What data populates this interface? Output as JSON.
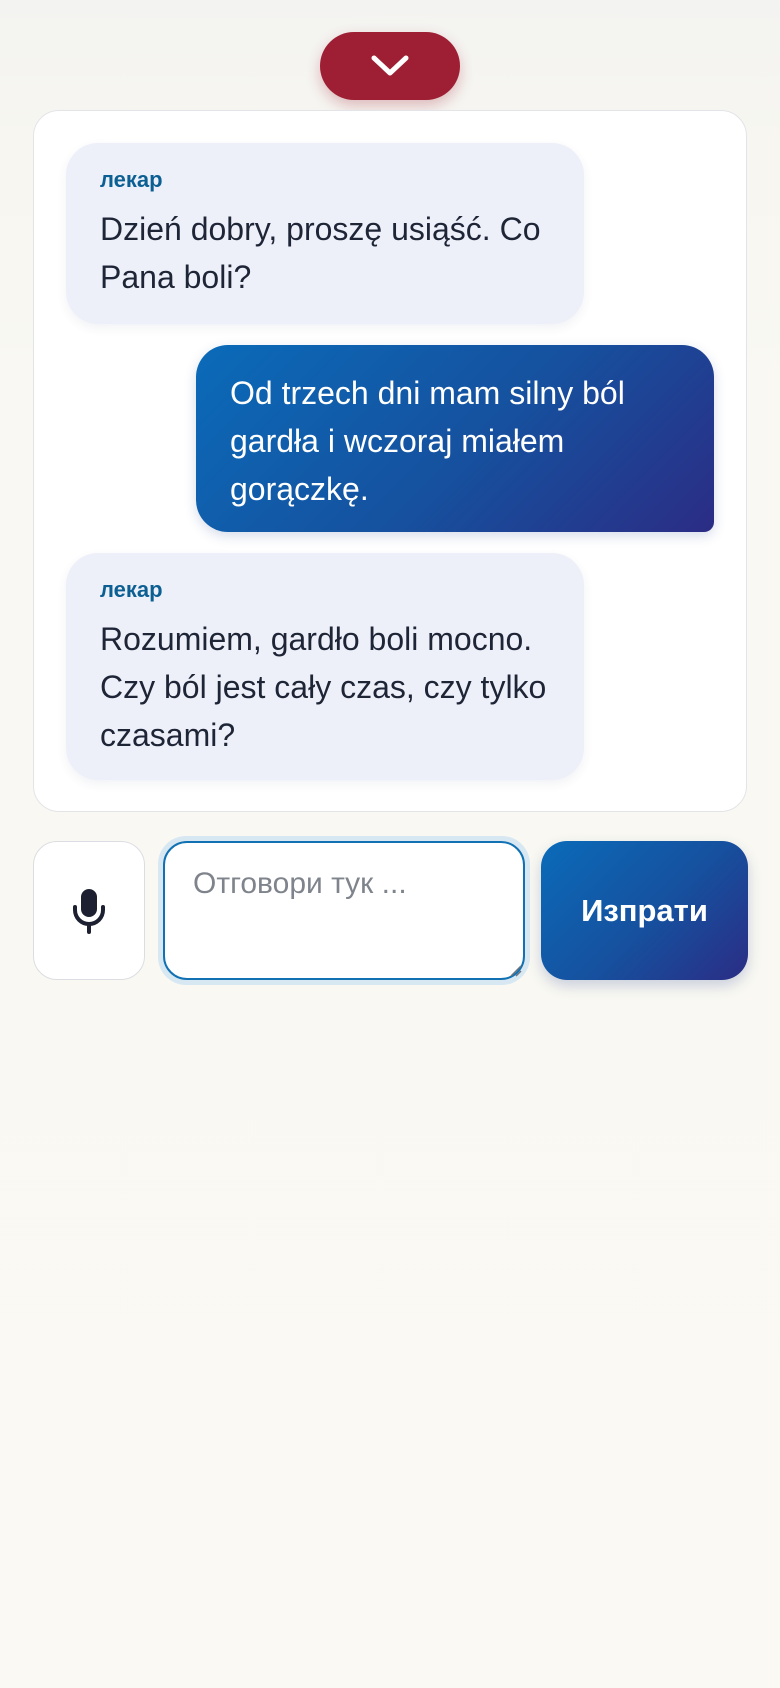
{
  "toolbar": {
    "collapse_icon": "chevron-down-icon",
    "accent_color": "#9e1f33"
  },
  "messages": [
    {
      "role": "bot",
      "speaker": "лекар",
      "text": "Dzień dobry, proszę usiąść. Co Pana boli?"
    },
    {
      "role": "user",
      "speaker": "",
      "text": "Od trzech dni mam silny ból gardła i wczoraj miałem gorączkę."
    },
    {
      "role": "bot",
      "speaker": "лекар",
      "text": "Rozumiem, gardło boli mocno. Czy ból jest cały czas, czy tylko czasami?"
    }
  ],
  "composer": {
    "mic_icon": "microphone-icon",
    "input_value": "",
    "input_placeholder": "Отговори тук ...",
    "send_label": "Изпрати",
    "send_gradient": [
      "#0a6bb9",
      "#2b2c84"
    ]
  }
}
